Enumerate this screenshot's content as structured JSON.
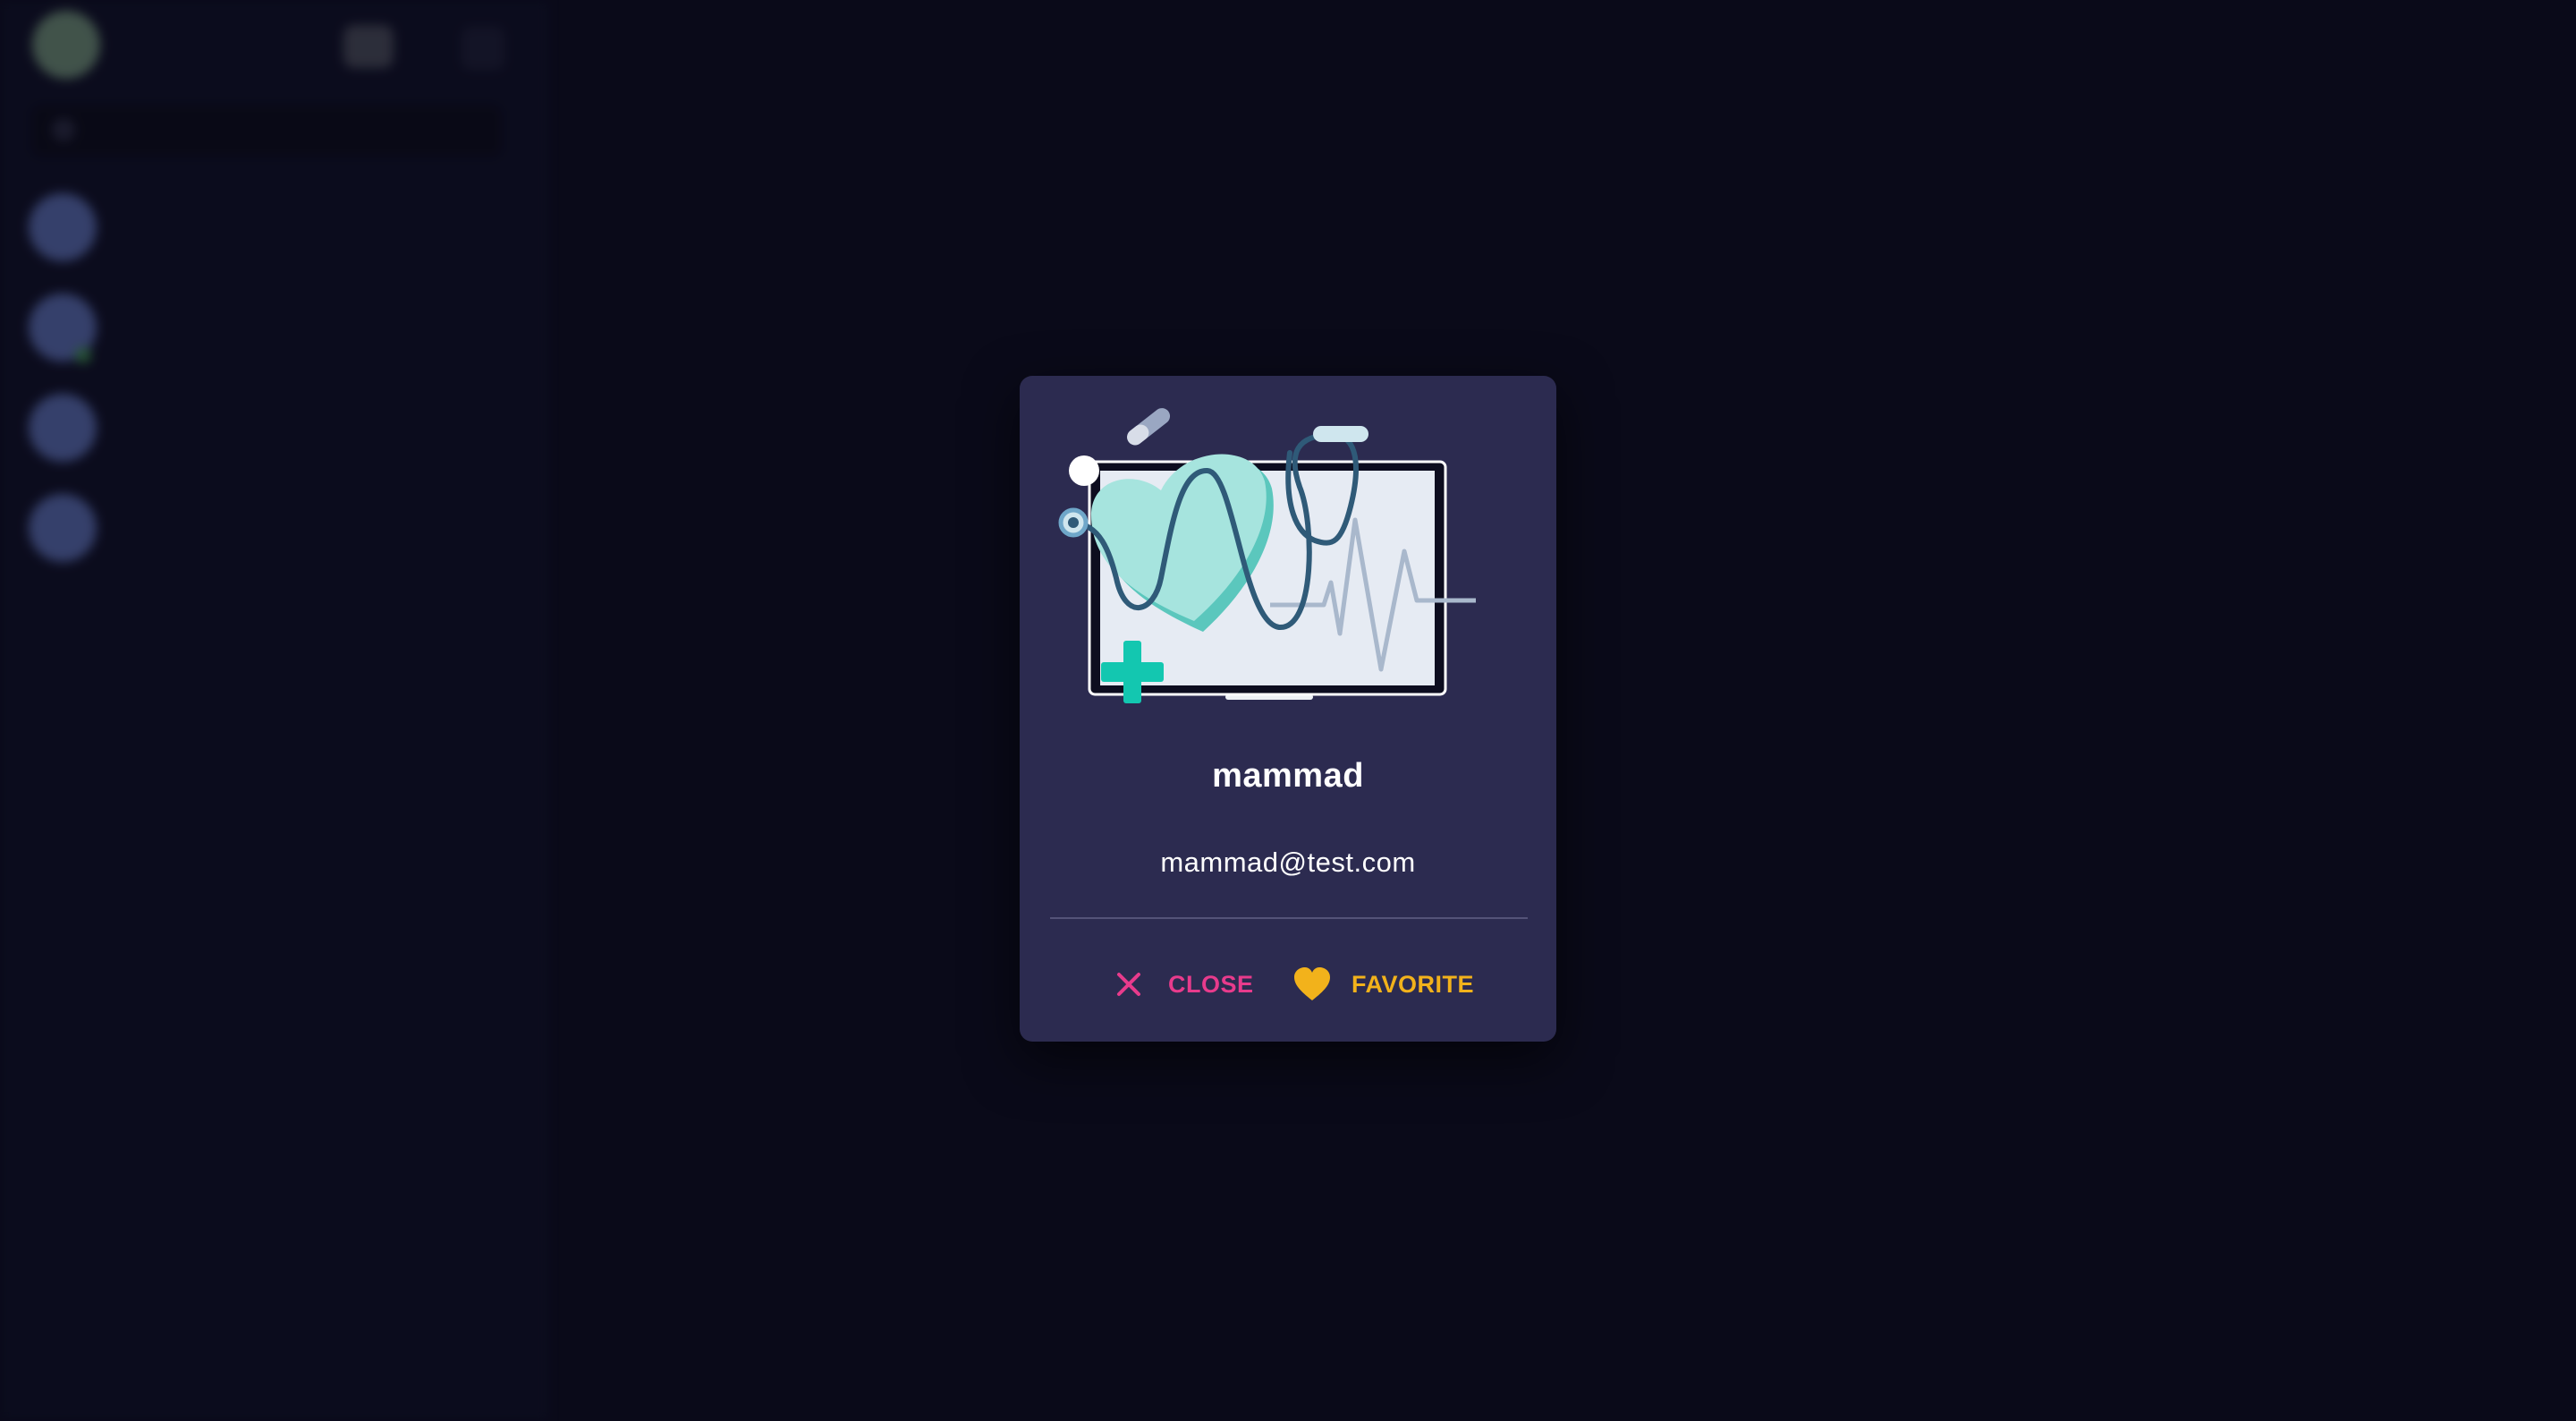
{
  "profile": {
    "name": "mammad",
    "email": "mammad@test.com"
  },
  "actions": {
    "close_label": "CLOSE",
    "favorite_label": "FAVORITE"
  },
  "icons": {
    "close": "close-icon",
    "favorite": "heart-icon",
    "illustration": "health-monitor-illustration"
  },
  "colors": {
    "background": "#0b0b1c",
    "dialog": "#2c2b50",
    "close_accent": "#e83b8c",
    "favorite_accent": "#f2b21b",
    "illustration_accent": "#13c7b0"
  }
}
